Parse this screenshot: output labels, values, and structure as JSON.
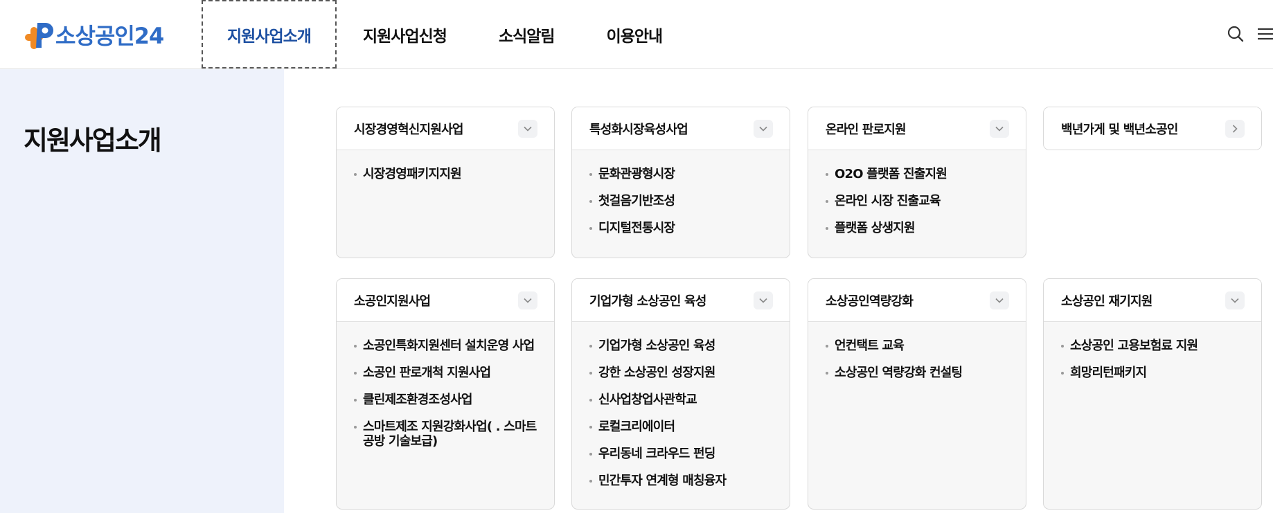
{
  "header": {
    "logo_text": "소상공인24",
    "nav": [
      "지원사업소개",
      "지원사업신청",
      "소식알림",
      "이용안내"
    ],
    "active_nav": 0,
    "icons": [
      "search-icon",
      "menu-icon"
    ]
  },
  "page": {
    "title": "지원사업소개"
  },
  "colors": {
    "brand_blue": "#2f6cc6",
    "brand_orange": "#f08a24",
    "active_nav": "#1c4fa1",
    "side_bg": "#eef2fb"
  },
  "cards": [
    {
      "title": "시장경영혁신지원사업",
      "toggle_icon": "chevron-down-icon",
      "items": [
        "시장경영패키지지원"
      ]
    },
    {
      "title": "특성화시장육성사업",
      "toggle_icon": "chevron-down-icon",
      "items": [
        "문화관광형시장",
        "첫걸음기반조성",
        "디지털전통시장"
      ]
    },
    {
      "title": "온라인 판로지원",
      "toggle_icon": "chevron-down-icon",
      "items": [
        "O2O 플랫폼 진출지원",
        "온라인 시장 진출교육",
        "플랫폼 상생지원"
      ]
    },
    {
      "title": "백년가게 및 백년소공인",
      "toggle_icon": "chevron-right-icon",
      "items": []
    },
    {
      "title": "소공인지원사업",
      "toggle_icon": "chevron-down-icon",
      "items": [
        "소공인특화지원센터 설치운영 사업",
        "소공인 판로개척 지원사업",
        "클린제조환경조성사업",
        "스마트제조 지원강화사업(   .   스마트공방 기술보급)"
      ]
    },
    {
      "title": "기업가형 소상공인 육성",
      "toggle_icon": "chevron-down-icon",
      "items": [
        "기업가형 소상공인 육성",
        "강한 소상공인 성장지원",
        "신사업창업사관학교",
        "로컬크리에이터",
        "우리동네 크라우드 펀딩",
        "민간투자 연계형 매칭융자"
      ]
    },
    {
      "title": "소상공인역량강화",
      "toggle_icon": "chevron-down-icon",
      "items": [
        "언컨택트 교육",
        "소상공인 역량강화 컨설팅"
      ]
    },
    {
      "title": "소상공인 재기지원",
      "toggle_icon": "chevron-down-icon",
      "items": [
        "소상공인 고용보험료 지원",
        "희망리턴패키지"
      ]
    }
  ]
}
